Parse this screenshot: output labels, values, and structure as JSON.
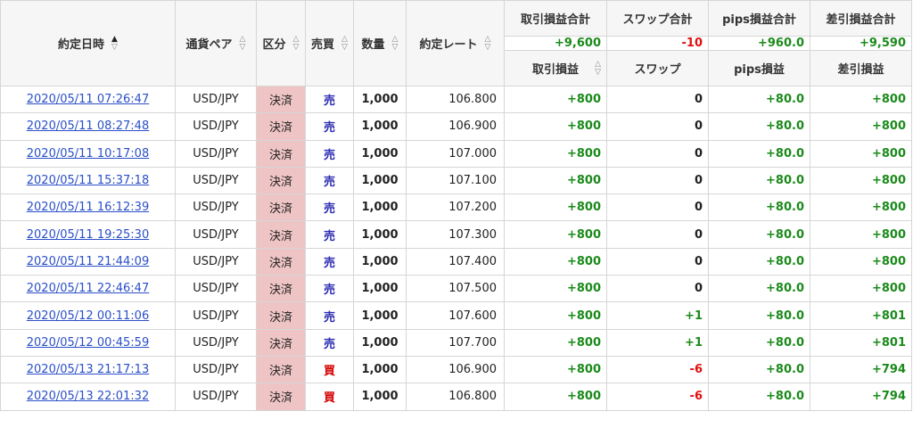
{
  "headers": {
    "date": "約定日時",
    "pair": "通貨ペア",
    "kubun": "区分",
    "side": "売買",
    "qty": "数量",
    "rate": "約定レート",
    "group_pl_total": "取引損益合計",
    "group_swap_total": "スワップ合計",
    "group_pips_total": "pips損益合計",
    "group_net_total": "差引損益合計",
    "pl": "取引損益",
    "swap": "スワップ",
    "pips": "pips損益",
    "net": "差引損益"
  },
  "totals": {
    "pl": "+9,600",
    "swap": "-10",
    "pips": "+960.0",
    "net": "+9,590"
  },
  "rows": [
    {
      "date": "2020/05/11 07:26:47",
      "pair": "USD/JPY",
      "kubun": "決済",
      "side": "売",
      "qty": "1,000",
      "rate": "106.800",
      "pl": "+800",
      "swap": "0",
      "pips": "+80.0",
      "net": "+800"
    },
    {
      "date": "2020/05/11 08:27:48",
      "pair": "USD/JPY",
      "kubun": "決済",
      "side": "売",
      "qty": "1,000",
      "rate": "106.900",
      "pl": "+800",
      "swap": "0",
      "pips": "+80.0",
      "net": "+800"
    },
    {
      "date": "2020/05/11 10:17:08",
      "pair": "USD/JPY",
      "kubun": "決済",
      "side": "売",
      "qty": "1,000",
      "rate": "107.000",
      "pl": "+800",
      "swap": "0",
      "pips": "+80.0",
      "net": "+800"
    },
    {
      "date": "2020/05/11 15:37:18",
      "pair": "USD/JPY",
      "kubun": "決済",
      "side": "売",
      "qty": "1,000",
      "rate": "107.100",
      "pl": "+800",
      "swap": "0",
      "pips": "+80.0",
      "net": "+800"
    },
    {
      "date": "2020/05/11 16:12:39",
      "pair": "USD/JPY",
      "kubun": "決済",
      "side": "売",
      "qty": "1,000",
      "rate": "107.200",
      "pl": "+800",
      "swap": "0",
      "pips": "+80.0",
      "net": "+800"
    },
    {
      "date": "2020/05/11 19:25:30",
      "pair": "USD/JPY",
      "kubun": "決済",
      "side": "売",
      "qty": "1,000",
      "rate": "107.300",
      "pl": "+800",
      "swap": "0",
      "pips": "+80.0",
      "net": "+800"
    },
    {
      "date": "2020/05/11 21:44:09",
      "pair": "USD/JPY",
      "kubun": "決済",
      "side": "売",
      "qty": "1,000",
      "rate": "107.400",
      "pl": "+800",
      "swap": "0",
      "pips": "+80.0",
      "net": "+800"
    },
    {
      "date": "2020/05/11 22:46:47",
      "pair": "USD/JPY",
      "kubun": "決済",
      "side": "売",
      "qty": "1,000",
      "rate": "107.500",
      "pl": "+800",
      "swap": "0",
      "pips": "+80.0",
      "net": "+800"
    },
    {
      "date": "2020/05/12 00:11:06",
      "pair": "USD/JPY",
      "kubun": "決済",
      "side": "売",
      "qty": "1,000",
      "rate": "107.600",
      "pl": "+800",
      "swap": "+1",
      "pips": "+80.0",
      "net": "+801"
    },
    {
      "date": "2020/05/12 00:45:59",
      "pair": "USD/JPY",
      "kubun": "決済",
      "side": "売",
      "qty": "1,000",
      "rate": "107.700",
      "pl": "+800",
      "swap": "+1",
      "pips": "+80.0",
      "net": "+801"
    },
    {
      "date": "2020/05/13 21:17:13",
      "pair": "USD/JPY",
      "kubun": "決済",
      "side": "買",
      "qty": "1,000",
      "rate": "106.900",
      "pl": "+800",
      "swap": "-6",
      "pips": "+80.0",
      "net": "+794"
    },
    {
      "date": "2020/05/13 22:01:32",
      "pair": "USD/JPY",
      "kubun": "決済",
      "side": "買",
      "qty": "1,000",
      "rate": "106.800",
      "pl": "+800",
      "swap": "-6",
      "pips": "+80.0",
      "net": "+794"
    }
  ],
  "colors": {
    "positive": "#1a8a1a",
    "negative": "#e01010",
    "link": "#2a4fc8",
    "sell": "#2a2ab0",
    "buy": "#d40000",
    "kubun_bg": "#efc4c4"
  },
  "icons": {
    "sort_active": "sort-asc-active-icon",
    "sort_idle": "sort-toggle-icon"
  }
}
